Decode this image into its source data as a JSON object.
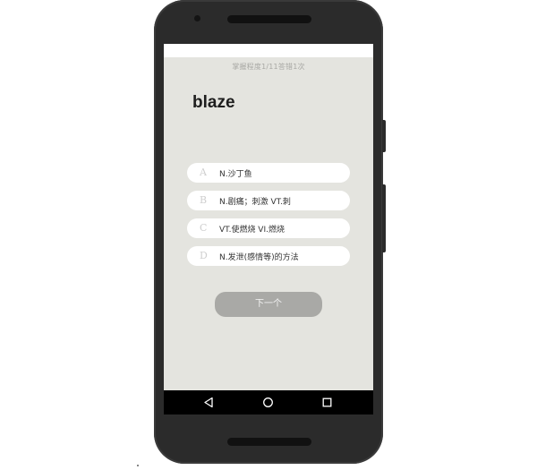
{
  "app": {
    "progress_text": "掌握程度1/11答错1次",
    "word": "blaze",
    "options": [
      {
        "letter": "A",
        "text": "N.沙丁鱼"
      },
      {
        "letter": "B",
        "text": "N.剧痛；刺激 VT.刺"
      },
      {
        "letter": "C",
        "text": "VT.使燃烧 VI.燃烧"
      },
      {
        "letter": "D",
        "text": "N.发泄(感情等)的方法"
      }
    ],
    "next_label": "下一个"
  },
  "nav": {
    "back_icon": "back-triangle-icon",
    "home_icon": "home-circle-icon",
    "recent_icon": "recent-square-icon"
  },
  "colors": {
    "app_background": "#e4e4df",
    "option_background": "#ffffff",
    "button_background": "#a9a9a6",
    "phone_body": "#2b2b2b",
    "nav_bar": "#000000"
  }
}
